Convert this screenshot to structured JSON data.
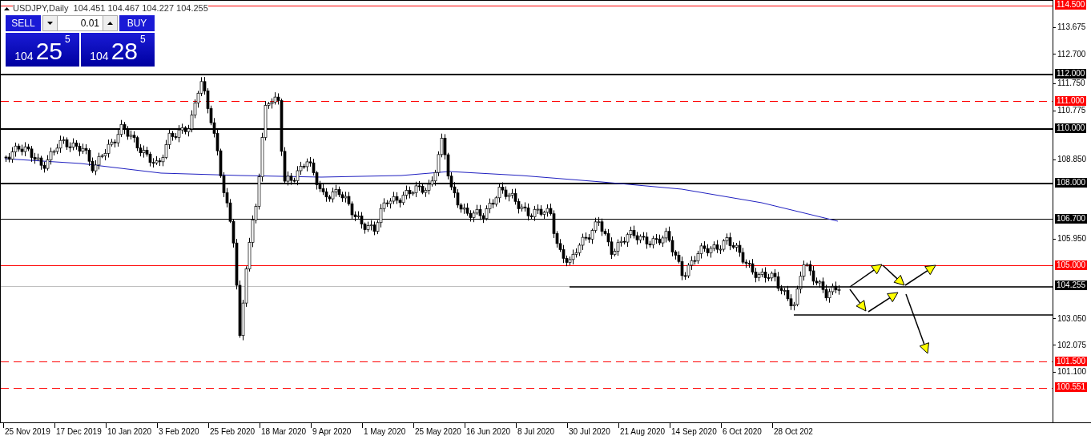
{
  "symbol_bar": {
    "text": "USDJPY,Daily  104.451 104.467 104.227 104.255"
  },
  "trade_panel": {
    "sell_label": "SELL",
    "buy_label": "BUY",
    "lot": "0.01",
    "sell_price": {
      "big": "104",
      "main": "25",
      "sup": "5"
    },
    "buy_price": {
      "big": "104",
      "main": "28",
      "sup": "5"
    }
  },
  "levels": [
    {
      "label": "114.500",
      "kind": "thin",
      "color": "#ff0000"
    },
    {
      "label": "112.000",
      "kind": "thick",
      "color": "#000000"
    },
    {
      "label": "111.000",
      "kind": "dashed",
      "color": "#ff0000"
    },
    {
      "label": "110.000",
      "kind": "thick",
      "color": "#000000"
    },
    {
      "label": "108.000",
      "kind": "thick",
      "color": "#000000"
    },
    {
      "label": "106.700",
      "kind": "thin",
      "color": "#000000"
    },
    {
      "label": "105.000",
      "kind": "thin",
      "color": "#ff0000"
    },
    {
      "label": "104.255",
      "kind": "thin",
      "color": "#c0c0c0"
    },
    {
      "label": "101.500",
      "kind": "dashed",
      "color": "#ff0000"
    },
    {
      "label": "100.551",
      "kind": "dashed",
      "color": "#ff0000"
    }
  ],
  "price_ticks": [
    "113.675",
    "112.700",
    "111.750",
    "110.775",
    "108.850",
    "105.950",
    "103.050",
    "102.075",
    "101.100"
  ],
  "date_labels": [
    "25 Nov 2019",
    "17 Dec 2019",
    "10 Jan 2020",
    "3 Feb 2020",
    "25 Feb 2020",
    "18 Mar 2020",
    "9 Apr 2020",
    "1 May 2020",
    "25 May 2020",
    "16 Jun 2020",
    "8 Jul 2020",
    "30 Jul 2020",
    "21 Aug 2020",
    "14 Sep 2020",
    "6 Oct 2020",
    "28 Oct 202"
  ]
}
